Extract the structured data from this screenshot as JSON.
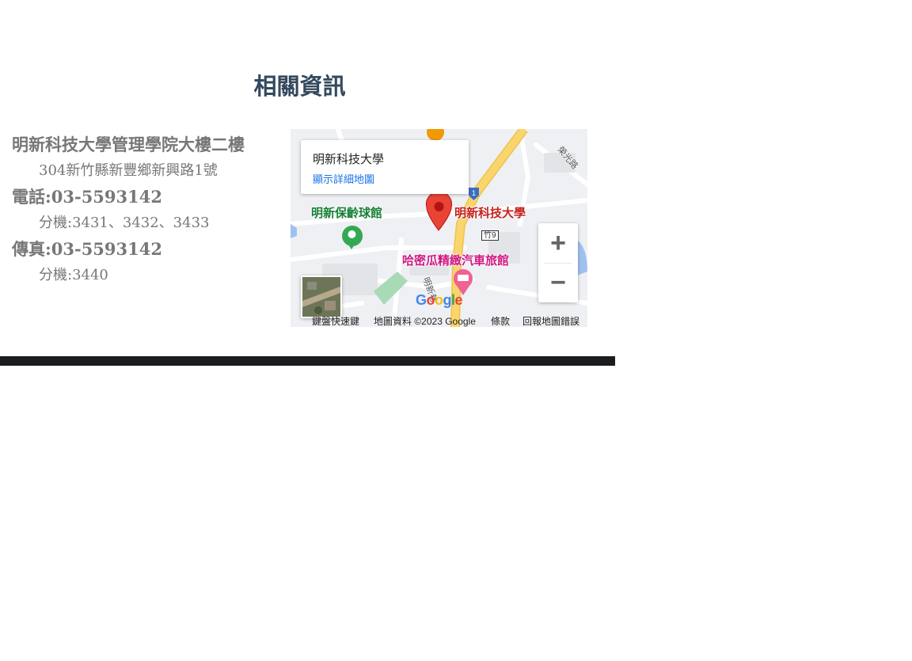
{
  "section": {
    "title": "相關資訊"
  },
  "info": {
    "name": "明新科技大學管理學院大樓二樓",
    "address": "304新竹縣新豐鄉新興路1號",
    "phone_label": "電話:03-5593142",
    "phone_ext": "分機:3431、3432、3433",
    "fax_label": "傳真:03-5593142",
    "fax_ext": "分機:3440"
  },
  "map": {
    "place_name": "明新科技大學",
    "place_link": "顯示詳細地圖",
    "marker_label": "明新科技大學",
    "poi_bowling": "明新保齡球館",
    "poi_motel": "哈密瓜精緻汽車旅館",
    "road_badge": "竹9",
    "route_badge": "1",
    "street_label": "明新巷",
    "street_label_2": "榮光路",
    "zoom_in": "+",
    "zoom_out": "−",
    "logo": "Google",
    "footer_shortcuts": "鍵盤快速鍵",
    "footer_data": "地圖資料 ©2023 Google",
    "footer_terms": "條款",
    "footer_report": "回報地圖錯誤",
    "colors": {
      "road_major": "#f9d56e",
      "water": "#9fc1f0",
      "park": "#a8dab5",
      "marker_red": "#ea4335",
      "poi_green": "#188038",
      "poi_pink": "#d01884"
    }
  }
}
